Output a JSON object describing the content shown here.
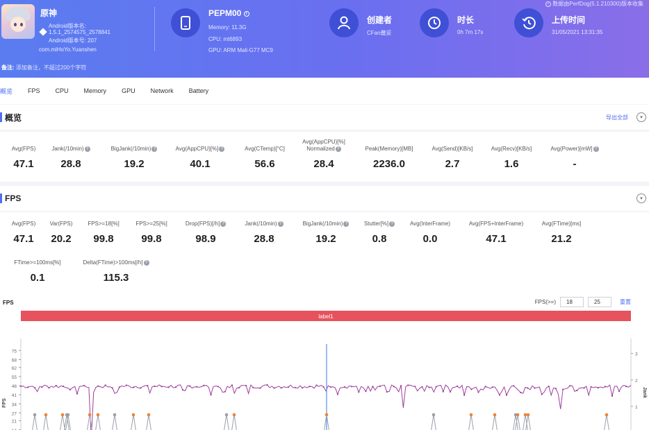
{
  "header": {
    "app": {
      "name": "原神",
      "android_version_label": "Android版本名:",
      "android_version": "1.5.1_2574575_2578841",
      "android_version_code": "Android版本号: 207",
      "package": "com.miHoYo.Yuanshen"
    },
    "device": {
      "name": "PEPM00",
      "memory": "Memory: 11.3G",
      "cpu": "CPU: mt6893",
      "gpu": "GPU: ARM Mali-G77 MC9"
    },
    "creator": {
      "title": "创建者",
      "value": "CFan畿妥"
    },
    "duration": {
      "title": "时长",
      "value": "0h 7m 17s"
    },
    "upload": {
      "title": "上传时间",
      "value": "31/05/2021 13:31:35"
    },
    "source_note": "数据由PerfDog(5.1.210300)版本收集",
    "note_label": "备注:",
    "note_placeholder": "添加备注，不超过200个字符"
  },
  "tabs": [
    "概览",
    "FPS",
    "CPU",
    "Memory",
    "GPU",
    "Network",
    "Battery"
  ],
  "overview": {
    "title": "概览",
    "export_label": "导出全部",
    "metrics": [
      {
        "label": "Avg(FPS)",
        "value": "47.1",
        "info": false
      },
      {
        "label": "Jank(/10min)",
        "value": "28.8",
        "info": true
      },
      {
        "label": "BigJank(/10min)",
        "value": "19.2",
        "info": true
      },
      {
        "label": "Avg(AppCPU)[%]",
        "value": "40.1",
        "info": true
      },
      {
        "label": "Avg(CTemp)[°C]",
        "value": "56.6",
        "info": false
      },
      {
        "label": "Avg(AppCPU)[%]",
        "label2": "Normalized",
        "value": "28.4",
        "info": true
      },
      {
        "label": "Peak(Memory)[MB]",
        "value": "2236.0",
        "info": false
      },
      {
        "label": "Avg(Send)[KB/s]",
        "value": "2.7",
        "info": false
      },
      {
        "label": "Avg(Recv)[KB/s]",
        "value": "1.6",
        "info": false
      },
      {
        "label": "Avg(Power)[mW]",
        "value": "-",
        "info": true
      }
    ]
  },
  "fps_section": {
    "title": "FPS",
    "metrics_row1": [
      {
        "label": "Avg(FPS)",
        "value": "47.1",
        "info": false
      },
      {
        "label": "Var(FPS)",
        "value": "20.2",
        "info": false
      },
      {
        "label": "FPS>=18[%]",
        "value": "99.8",
        "info": false
      },
      {
        "label": "FPS>=25[%]",
        "value": "99.8",
        "info": false
      },
      {
        "label": "Drop(FPS)[/h]",
        "value": "98.9",
        "info": true
      },
      {
        "label": "Jank(/10min)",
        "value": "28.8",
        "info": true
      },
      {
        "label": "BigJank(/10min)",
        "value": "19.2",
        "info": true
      },
      {
        "label": "Stutter[%]",
        "value": "0.8",
        "info": true
      },
      {
        "label": "Avg(InterFrame)",
        "value": "0.0",
        "info": false
      },
      {
        "label": "Avg(FPS+InterFrame)",
        "value": "47.1",
        "info": false
      },
      {
        "label": "Avg(FTime)[ms]",
        "value": "21.2",
        "info": false
      }
    ],
    "metrics_row2": [
      {
        "label": "FTime>=100ms[%]",
        "value": "0.1",
        "info": false
      },
      {
        "label": "Delta(FTime)>100ms[/h]",
        "value": "115.3",
        "info": true
      }
    ]
  },
  "chart": {
    "label": "FPS",
    "fps_filter_label": "FPS(>=)",
    "fps_min_1": "18",
    "fps_min_2": "25",
    "reset_label": "重置",
    "band_label": "label1",
    "y_axis_title": "FPS",
    "y2_axis_title": "Jank",
    "colors": {
      "band": "#e6525d",
      "fps_line": "#9b3e9b",
      "jank": "#9aa0aa",
      "big_jank": "#e8843c",
      "accent": "#4f6ef0"
    }
  },
  "chart_data": {
    "type": "line",
    "title": "FPS",
    "ylabel": "FPS",
    "y2label": "Jank",
    "ylim": [
      0,
      80
    ],
    "y_ticks": [
      7,
      14,
      21,
      27,
      34,
      41,
      48,
      55,
      62,
      68,
      75
    ],
    "y2_ticks": [
      1,
      2,
      3
    ],
    "series": [
      {
        "name": "FPS",
        "mean": 47.1,
        "typical_range": [
          40,
          50
        ]
      },
      {
        "name": "Jank",
        "spike_count": 21
      }
    ],
    "dips": [
      {
        "fps": 7
      },
      {
        "fps": 31
      },
      {
        "fps": 40
      },
      {
        "fps": 30
      }
    ]
  }
}
